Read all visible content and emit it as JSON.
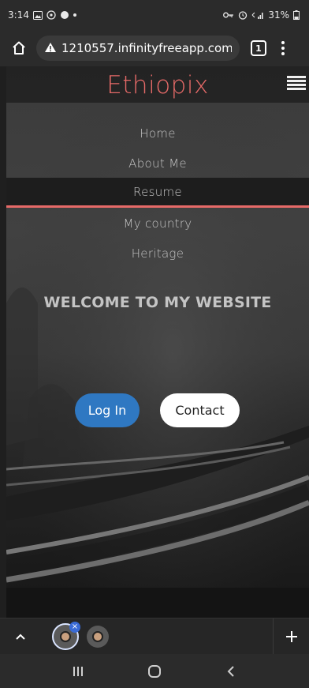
{
  "status_bar": {
    "time": "3:14",
    "battery": "31%"
  },
  "browser": {
    "url": "1210557.infinityfreeapp.com",
    "tab_count": "1"
  },
  "site": {
    "title": "Ethiopix",
    "nav": [
      {
        "label": "Home",
        "active": false
      },
      {
        "label": "About Me",
        "active": false
      },
      {
        "label": "Resume",
        "active": true
      },
      {
        "label": "My country",
        "active": false
      },
      {
        "label": "Heritage",
        "active": false
      }
    ],
    "welcome": "WELCOME TO MY WEBSITE",
    "buttons": {
      "login": "Log In",
      "contact": "Contact"
    }
  },
  "colors": {
    "brand": "#e66a68",
    "login_button": "#2f78c2"
  },
  "icons": {
    "home": "home-icon",
    "warning": "warning-icon",
    "menu": "kebab-menu-icon",
    "hamburger": "hamburger-icon",
    "chevron_up": "chevron-up-icon",
    "add_tab": "plus-icon",
    "recents": "recents-icon",
    "home_button": "home-button-icon",
    "back": "back-icon"
  }
}
